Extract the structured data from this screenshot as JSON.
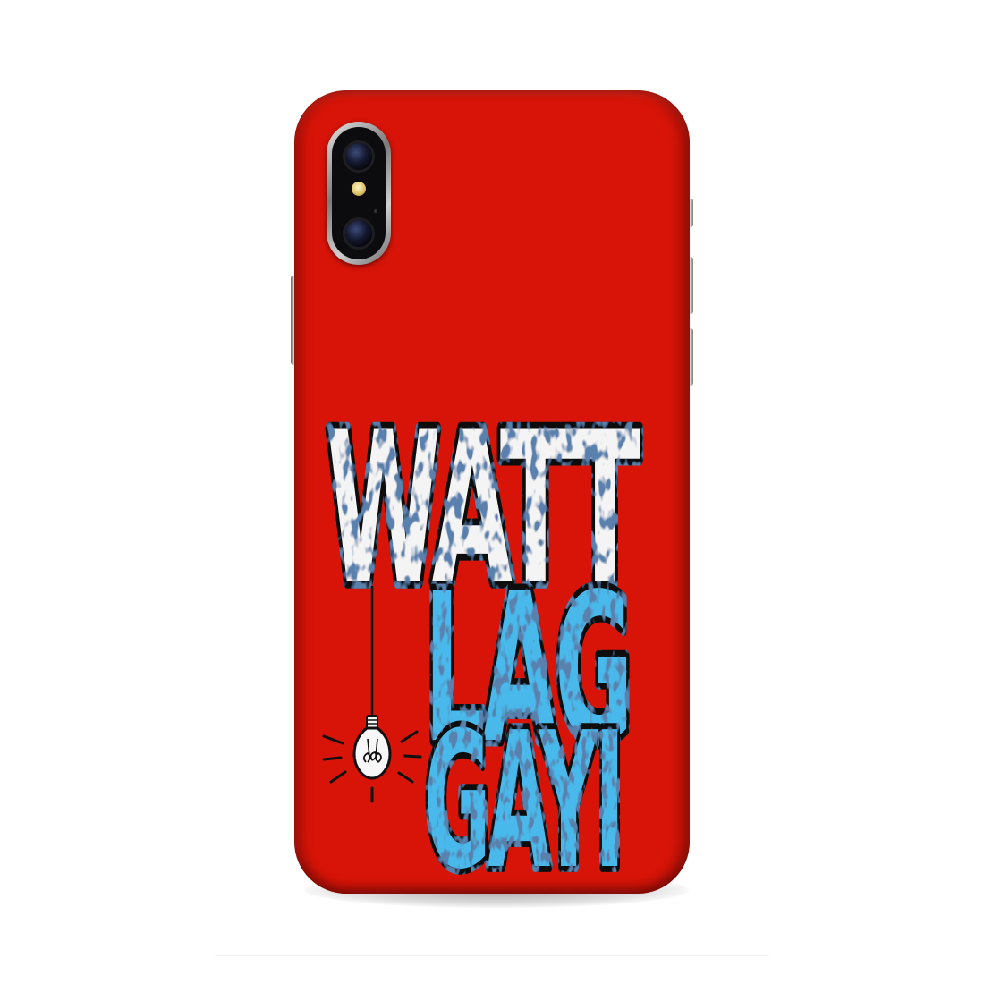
{
  "product": {
    "case_color": "#d81408",
    "print_text": {
      "line1": "WATT",
      "line2": "LAG",
      "line3": "GAYI"
    },
    "colors": {
      "line1_fill": "#f4f4f4",
      "line2_fill": "#49b8ea",
      "outline": "#111111",
      "speckle": "#1a3a6a"
    },
    "illustration": "hanging-light-bulb"
  }
}
